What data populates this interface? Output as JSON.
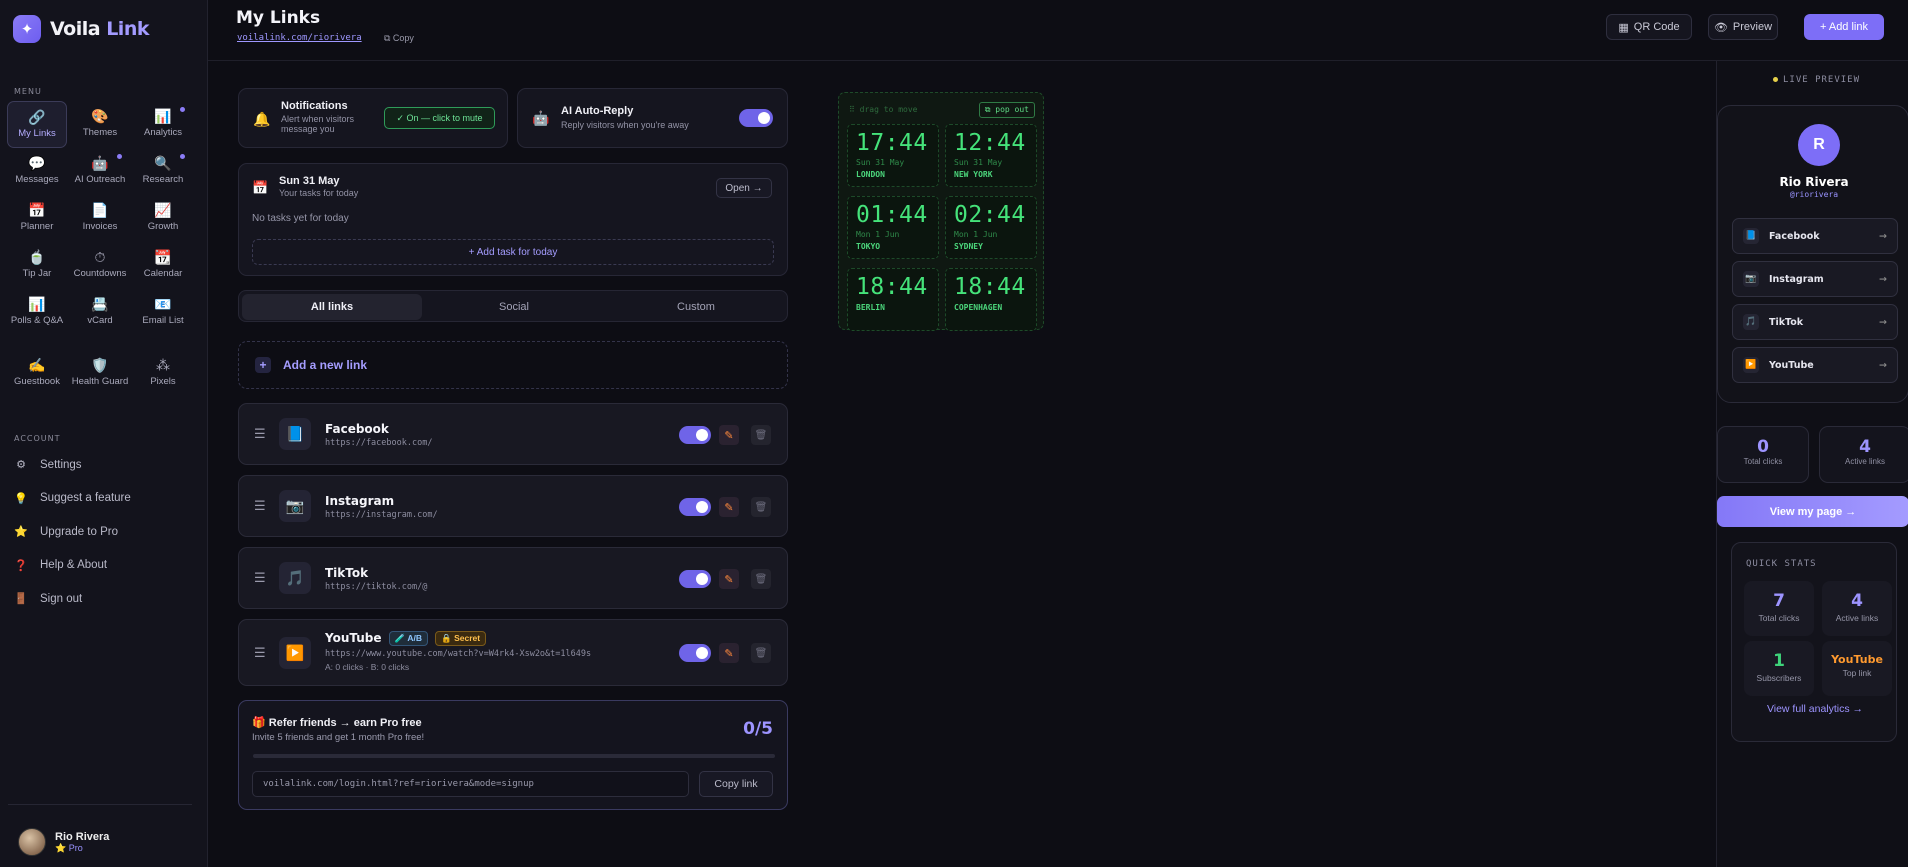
{
  "brand": {
    "mark": "✦",
    "name_a": "Voila",
    "name_b": "Link"
  },
  "sidebar": {
    "menu_label": "MENU",
    "items": [
      {
        "label": "My Links",
        "icon": "🔗",
        "active": true
      },
      {
        "label": "Themes",
        "icon": "🎨"
      },
      {
        "label": "Analytics",
        "icon": "📊",
        "dot": true
      },
      {
        "label": "Messages",
        "icon": "💬"
      },
      {
        "label": "AI Outreach",
        "icon": "🤖",
        "dot": true
      },
      {
        "label": "Research",
        "icon": "🔍",
        "dot": true
      },
      {
        "label": "Planner",
        "icon": "📅"
      },
      {
        "label": "Invoices",
        "icon": "📄"
      },
      {
        "label": "Growth",
        "icon": "📈"
      },
      {
        "label": "Tip Jar",
        "icon": "🍵"
      },
      {
        "label": "Countdowns",
        "icon": "⏱"
      },
      {
        "label": "Calendar",
        "icon": "📆"
      },
      {
        "label": "Polls & Q&A",
        "icon": "📊"
      },
      {
        "label": "vCard",
        "icon": "📇"
      },
      {
        "label": "Email List",
        "icon": "📧"
      },
      {
        "label": "Guestbook",
        "icon": "✍️"
      },
      {
        "label": "Health Guard",
        "icon": "🛡️"
      },
      {
        "label": "Pixels",
        "icon": "⁂"
      }
    ],
    "account_label": "ACCOUNT",
    "account": [
      {
        "label": "Settings",
        "icon": "⚙"
      },
      {
        "label": "Suggest a feature",
        "icon": "💡"
      },
      {
        "label": "Upgrade to Pro",
        "icon": "⭐"
      },
      {
        "label": "Help & About",
        "icon": "❓"
      },
      {
        "label": "Sign out",
        "icon": "🚪"
      }
    ],
    "user": {
      "name": "Rio Rivera",
      "plan": "⭐ Pro"
    }
  },
  "header": {
    "title": "My Links",
    "url": "voilalink.com/riorivera",
    "copy": "⧉ Copy",
    "qr": "QR Code",
    "preview": "Preview",
    "add": "+ Add link"
  },
  "notifications": {
    "title": "Notifications",
    "sub": "Alert when visitors message you",
    "pill": "✓ On — click to mute"
  },
  "autoreply": {
    "title": "AI Auto-Reply",
    "sub": "Reply visitors when you're away"
  },
  "tasks": {
    "date": "Sun 31 May",
    "sub": "Your tasks for today",
    "open": "Open →",
    "empty": "No tasks yet for today",
    "add": "+ Add task for today"
  },
  "tabs": [
    "All links",
    "Social",
    "Custom"
  ],
  "add_new": "Add a new link",
  "links": [
    {
      "name": "Facebook",
      "url": "https://facebook.com/",
      "icon": "📘"
    },
    {
      "name": "Instagram",
      "url": "https://instagram.com/",
      "icon": "📷"
    },
    {
      "name": "TikTok",
      "url": "https://tiktok.com/@",
      "icon": "🎵"
    },
    {
      "name": "YouTube",
      "url": "https://www.youtube.com/watch?v=W4rk4-Xsw2o&t=1l649s",
      "icon": "▶️",
      "badge_ab": "🧪 A/B",
      "badge_secret": "🔒 Secret",
      "stats": "A: 0 clicks · B: 0 clicks"
    }
  ],
  "refer": {
    "title": "🎁 Refer friends → earn Pro free",
    "sub": "Invite 5 friends and get 1 month Pro free!",
    "count": "0/5",
    "progress": 0,
    "link": "voilalink.com/login.html?ref=riorivera&mode=signup",
    "copy": "Copy link"
  },
  "clock": {
    "hint": "⠿ drag to move",
    "popout": "⧉ pop out",
    "cities": [
      {
        "time": "17:44",
        "date": "Sun 31 May",
        "city": "LONDON"
      },
      {
        "time": "12:44",
        "date": "Sun 31 May",
        "city": "NEW YORK"
      },
      {
        "time": "01:44",
        "date": "Mon 1 Jun",
        "city": "TOKYO"
      },
      {
        "time": "02:44",
        "date": "Mon 1 Jun",
        "city": "SYDNEY"
      },
      {
        "time": "18:44",
        "date": "",
        "city": "BERLIN"
      },
      {
        "time": "18:44",
        "date": "",
        "city": "COPENHAGEN"
      }
    ]
  },
  "preview": {
    "live": "LIVE PREVIEW",
    "initial": "R",
    "name": "Rio Rivera",
    "handle": "@riorivera",
    "links": [
      "Facebook",
      "Instagram",
      "TikTok",
      "YouTube"
    ],
    "link_icons": [
      "📘",
      "📷",
      "🎵",
      "▶️"
    ],
    "arrow": "→",
    "total_clicks": "0",
    "total_clicks_label": "Total clicks",
    "active_links": "4",
    "active_links_label": "Active links",
    "view": "View my page →"
  },
  "quick": {
    "title": "QUICK STATS",
    "total": "7",
    "total_label": "Total clicks",
    "active": "4",
    "active_label": "Active links",
    "subs": "1",
    "subs_label": "Subscribers",
    "top": "YouTube",
    "top_label": "Top link",
    "full": "View full analytics →"
  }
}
